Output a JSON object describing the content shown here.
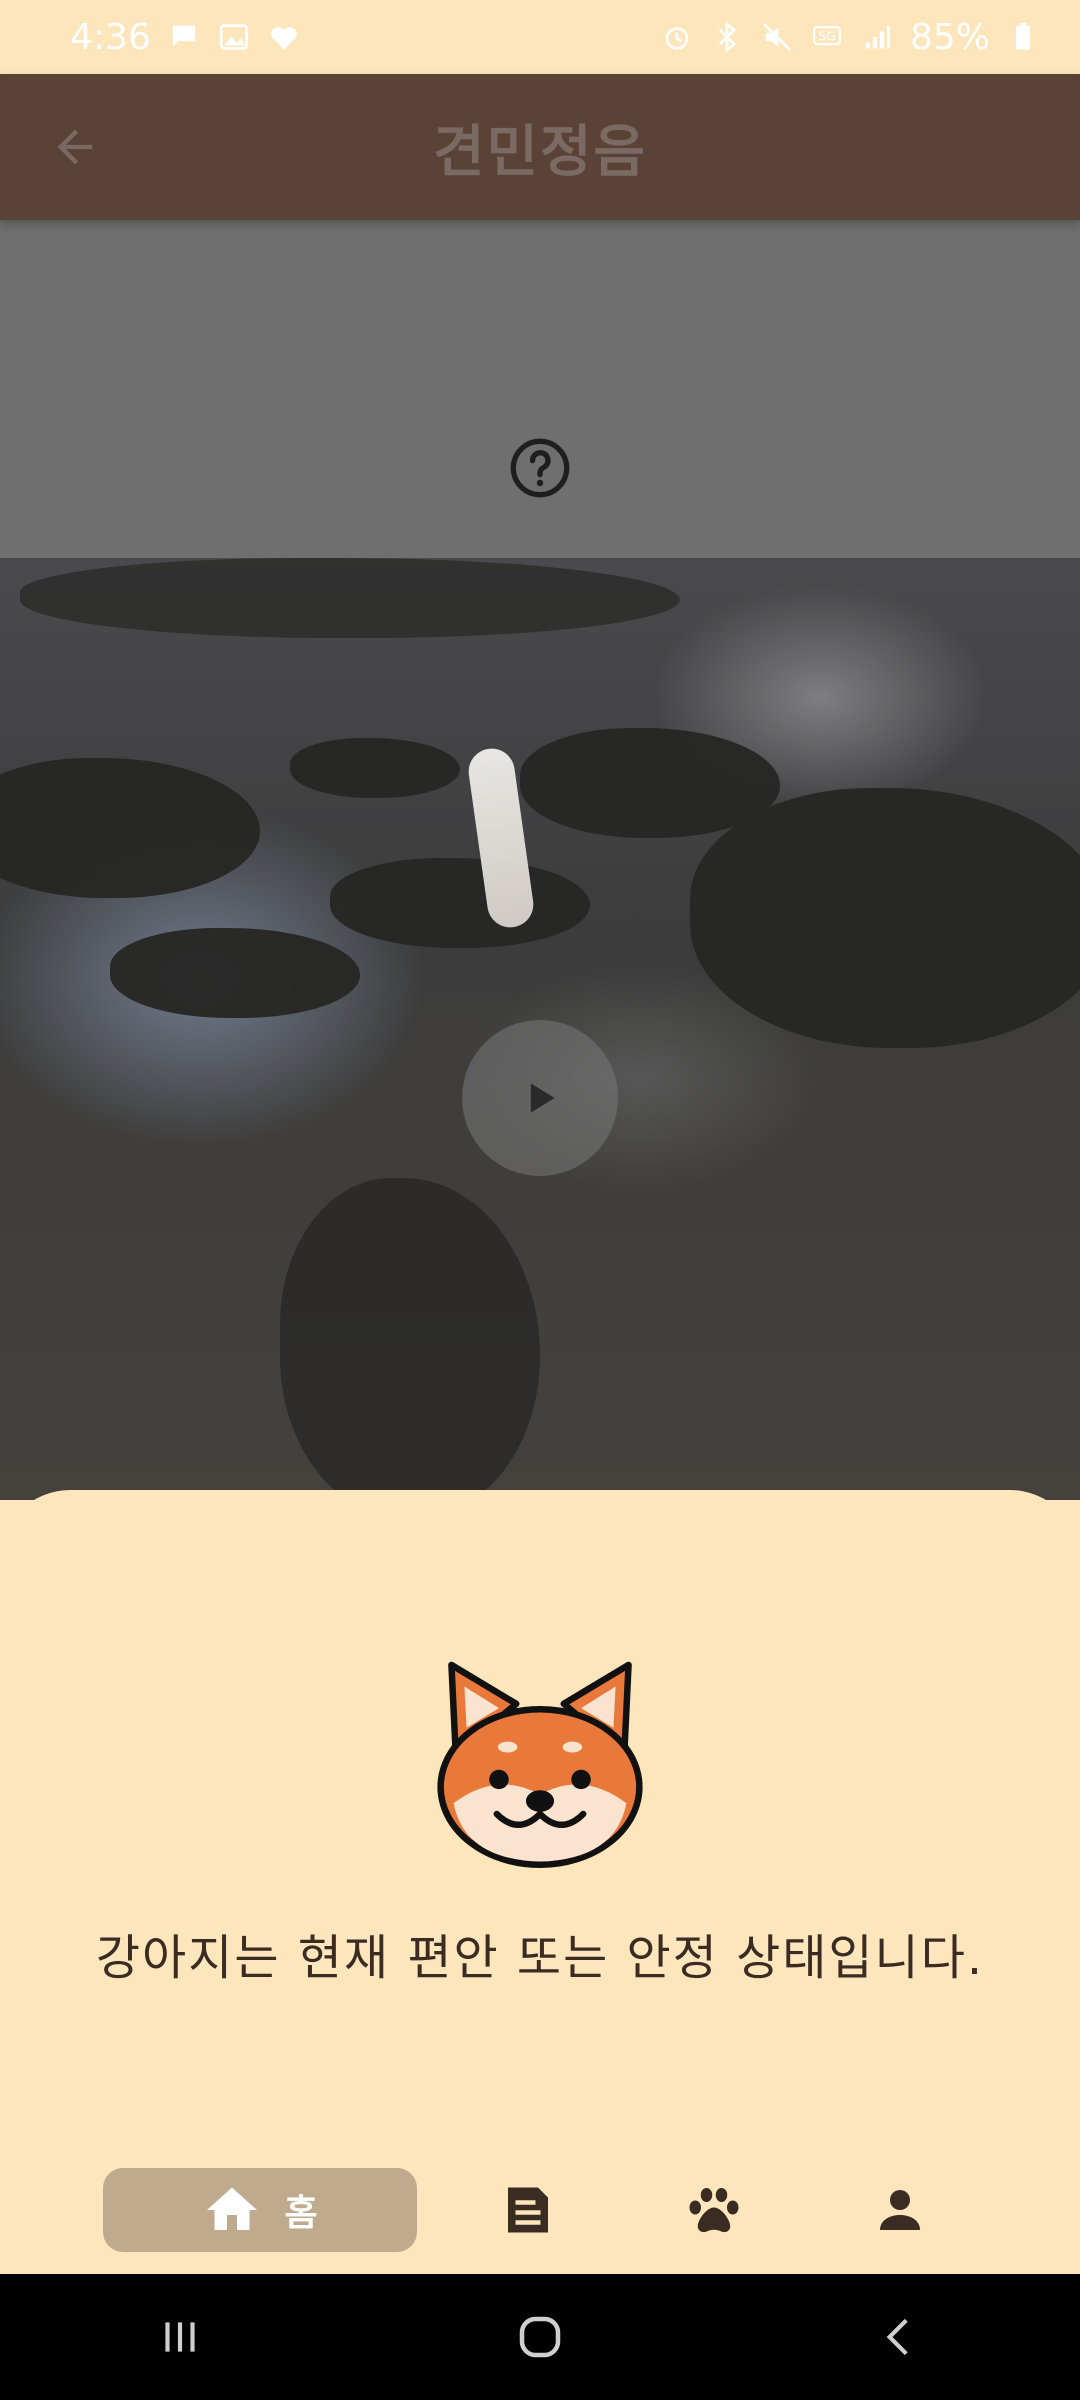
{
  "status_bar": {
    "time": "4:36",
    "battery": "85%",
    "icons_left": [
      "message-icon",
      "gallery-icon",
      "heart-icon"
    ],
    "icons_right": [
      "alarm-icon",
      "bluetooth-icon",
      "mute-icon",
      "5g-icon",
      "signal-icon",
      "battery-icon"
    ]
  },
  "app_bar": {
    "title": "견민정음",
    "back_icon": "arrow-left-icon"
  },
  "help": {
    "icon": "help-circle-icon"
  },
  "video": {
    "play_icon": "play-icon"
  },
  "sheet": {
    "mascot": "shiba-inu-face",
    "message": "강아지는 현재 편안 또는 안정 상태입니다."
  },
  "bottom_nav": {
    "items": [
      {
        "label": "홈",
        "icon": "home-icon",
        "active": true
      },
      {
        "label": "",
        "icon": "document-icon",
        "active": false
      },
      {
        "label": "",
        "icon": "paw-icon",
        "active": false
      },
      {
        "label": "",
        "icon": "person-icon",
        "active": false
      }
    ]
  },
  "colors": {
    "app_bar": "#5A4237",
    "background": "#FDE5BC",
    "nav_active": "#BFAA8E",
    "icon_dark": "#3A2B23"
  }
}
